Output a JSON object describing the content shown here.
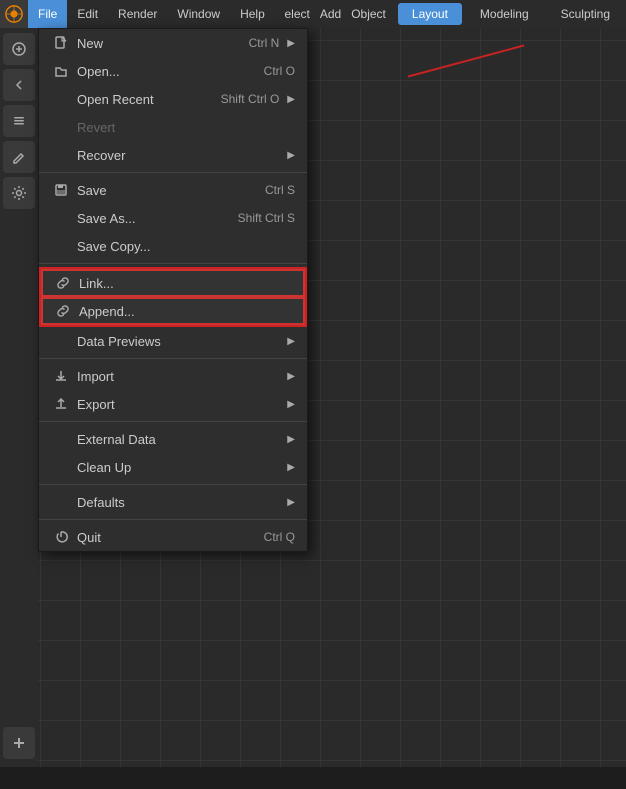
{
  "app": {
    "logo": "⬡",
    "title": "Blender"
  },
  "menubar": {
    "items": [
      {
        "id": "file",
        "label": "File",
        "active": true
      },
      {
        "id": "edit",
        "label": "Edit"
      },
      {
        "id": "render",
        "label": "Render"
      },
      {
        "id": "window",
        "label": "Window"
      },
      {
        "id": "help",
        "label": "Help"
      }
    ],
    "right_items": [
      "elect",
      "Add",
      "Object"
    ],
    "tabs": [
      {
        "id": "layout",
        "label": "Layout",
        "active": true
      },
      {
        "id": "modeling",
        "label": "Modeling"
      },
      {
        "id": "sculpting",
        "label": "Sculpting"
      }
    ]
  },
  "file_menu": {
    "items": [
      {
        "id": "new",
        "label": "New",
        "shortcut": "Ctrl N",
        "icon": "📄",
        "has_arrow": true,
        "disabled": false,
        "separator_after": false
      },
      {
        "id": "open",
        "label": "Open...",
        "shortcut": "Ctrl O",
        "icon": "📂",
        "has_arrow": false,
        "disabled": false,
        "separator_after": false
      },
      {
        "id": "open_recent",
        "label": "Open Recent",
        "shortcut": "Shift Ctrl O",
        "icon": "",
        "has_arrow": true,
        "disabled": false,
        "separator_after": false
      },
      {
        "id": "revert",
        "label": "Revert",
        "shortcut": "",
        "icon": "",
        "has_arrow": false,
        "disabled": true,
        "separator_after": false
      },
      {
        "id": "recover",
        "label": "Recover",
        "shortcut": "",
        "icon": "",
        "has_arrow": true,
        "disabled": false,
        "separator_after": true
      },
      {
        "id": "save",
        "label": "Save",
        "shortcut": "Ctrl S",
        "icon": "💾",
        "has_arrow": false,
        "disabled": false,
        "separator_after": false
      },
      {
        "id": "save_as",
        "label": "Save As...",
        "shortcut": "Shift Ctrl S",
        "icon": "",
        "has_arrow": false,
        "disabled": false,
        "separator_after": false
      },
      {
        "id": "save_copy",
        "label": "Save Copy...",
        "shortcut": "",
        "icon": "",
        "has_arrow": false,
        "disabled": false,
        "separator_after": true
      },
      {
        "id": "link",
        "label": "Link...",
        "shortcut": "",
        "icon": "🔗",
        "has_arrow": false,
        "disabled": false,
        "highlighted": true,
        "separator_after": false
      },
      {
        "id": "append",
        "label": "Append...",
        "shortcut": "",
        "icon": "🔗",
        "has_arrow": false,
        "disabled": false,
        "highlighted": true,
        "separator_after": false
      },
      {
        "id": "data_previews",
        "label": "Data Previews",
        "shortcut": "",
        "icon": "",
        "has_arrow": true,
        "disabled": false,
        "separator_after": true
      },
      {
        "id": "import",
        "label": "Import",
        "shortcut": "",
        "icon": "⬇",
        "has_arrow": true,
        "disabled": false,
        "separator_after": false
      },
      {
        "id": "export",
        "label": "Export",
        "shortcut": "",
        "icon": "⬆",
        "has_arrow": true,
        "disabled": false,
        "separator_after": true
      },
      {
        "id": "external_data",
        "label": "External Data",
        "shortcut": "",
        "icon": "",
        "has_arrow": true,
        "disabled": false,
        "separator_after": false
      },
      {
        "id": "clean_up",
        "label": "Clean Up",
        "shortcut": "",
        "icon": "",
        "has_arrow": true,
        "disabled": false,
        "separator_after": true
      },
      {
        "id": "defaults",
        "label": "Defaults",
        "shortcut": "",
        "icon": "",
        "has_arrow": true,
        "disabled": false,
        "separator_after": true
      },
      {
        "id": "quit",
        "label": "Quit",
        "shortcut": "Ctrl Q",
        "icon": "⏻",
        "has_arrow": false,
        "disabled": false,
        "separator_after": false
      }
    ]
  },
  "sidebar": {
    "icons": [
      "⊕",
      "↩",
      "⋮",
      "✏",
      "🔧",
      "+"
    ]
  },
  "statusbar": {
    "text": ""
  }
}
